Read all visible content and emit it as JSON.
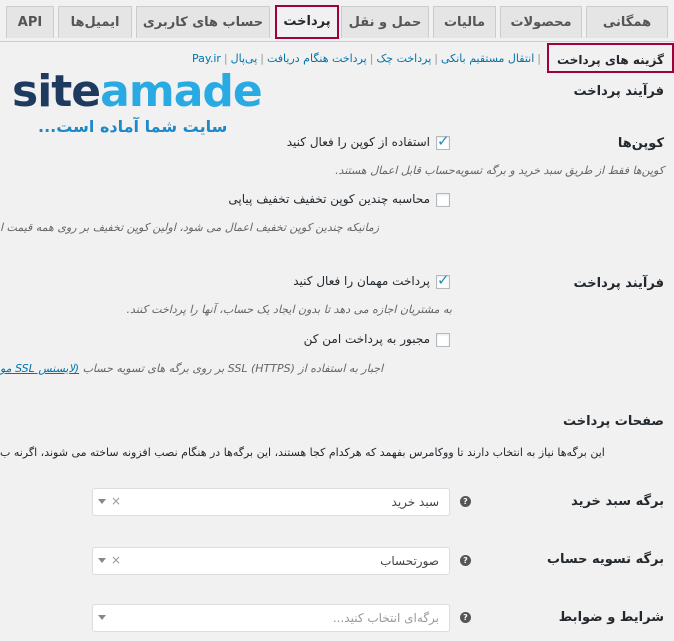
{
  "tabs": [
    {
      "label": "همگانی",
      "active": false
    },
    {
      "label": "محصولات",
      "active": false
    },
    {
      "label": "مالیات",
      "active": false
    },
    {
      "label": "حمل و نقل",
      "active": false
    },
    {
      "label": "پرداخت",
      "active": true
    },
    {
      "label": "حساب های کاربری",
      "active": false
    },
    {
      "label": "ایمیل‌ها",
      "active": false
    },
    {
      "label": "API",
      "active": false
    }
  ],
  "subnav": {
    "current": "گزینه های پرداخت",
    "links": [
      "انتقال مستقیم بانکی",
      "پرداخت چک",
      "پرداخت هنگام دریافت",
      "پی‌پال",
      "Pay.ir"
    ]
  },
  "logo": {
    "part1": "site",
    "part2": "amade",
    "tagline": "سایت شما آماده است..."
  },
  "checkout_process": {
    "heading": "فرآیند پرداخت",
    "coupons": {
      "label": "کوپن‌ها",
      "enable_label": "استفاده از کوپن را فعال کنید",
      "enable_checked": true,
      "enable_desc": "کوپن‌ها فقط از طریق سبد خرید و برگه تسویه‌حساب قابل اعمال هستند.",
      "sequential_label": "محاسبه چندین کوپن تخفیف تخفیف پیاپی",
      "sequential_checked": false,
      "sequential_desc": "زمانیکه چندین کوپن تخفیف اعمال می شود، اولین کوپن تخفیف بر روی همه قیمت ا"
    },
    "checkout": {
      "label": "فرآیند پرداخت",
      "guest_label": "پرداخت مهمان را فعال کنید",
      "guest_checked": true,
      "guest_desc": "به مشتریان اجازه می دهد تا بدون ایجاد یک حساب، آنها را پرداخت کنند.",
      "secure_label": "مجبور به پرداخت امن کن",
      "secure_checked": false,
      "secure_desc": "اجبار به استفاده از SSL (HTTPS) بر روی برگه های تسویه حساب",
      "secure_link": "(لایسنس SSL مو"
    }
  },
  "pages": {
    "heading": "صفحات پرداخت",
    "desc": "این برگه‌ها نیاز به انتخاب دارند تا ووکامرس بفهمد که هرکدام کجا هستند، این برگه‌ها در هنگام نصب افزونه ساخته می شوند، اگرنه ب",
    "cart": {
      "label": "برگه سبد خرید",
      "value": "سبد خرید"
    },
    "checkout": {
      "label": "برگه تسویه حساب",
      "value": "صورتحساب"
    },
    "terms": {
      "label": "شرایط و ضوابط",
      "placeholder": "برگه‌ای انتخاب کنید..."
    }
  },
  "colors": {
    "highlight_border": "#a0003e",
    "link": "#0073aa",
    "check": "#1e8cbe"
  }
}
